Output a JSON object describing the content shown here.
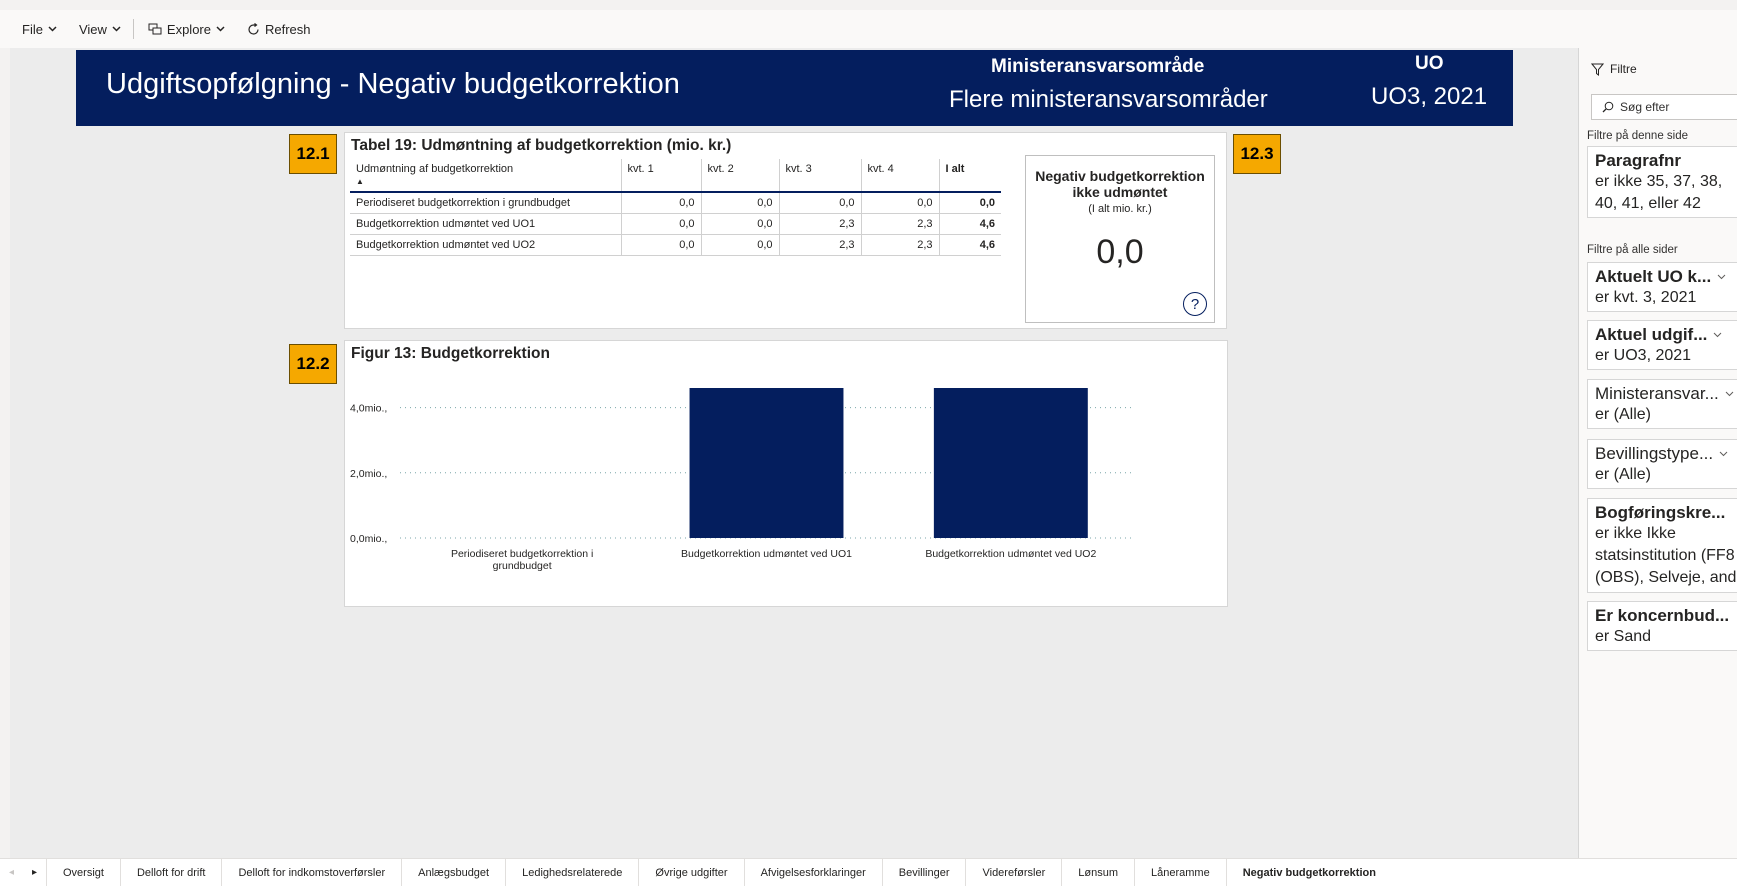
{
  "toolbar": {
    "file": "File",
    "view": "View",
    "explore": "Explore",
    "refresh": "Refresh"
  },
  "header": {
    "title": "Udgiftsopfølgning - Negativ budgetkorrektion",
    "ministry_label": "Ministeransvarsområde",
    "ministry_value": "Flere ministeransvarsområder",
    "uo_label": "UO",
    "uo_value": "UO3, 2021"
  },
  "badges": {
    "b1": "12.1",
    "b2": "12.2",
    "b3": "12.3"
  },
  "table": {
    "title": "Tabel 19: Udmøntning af budgetkorrektion (mio. kr.)",
    "headers": [
      "Udmøntning af budgetkorrektion",
      "kvt. 1",
      "kvt. 2",
      "kvt. 3",
      "kvt. 4",
      "I alt"
    ],
    "sort_indicator": "▲",
    "rows": [
      [
        "Periodiseret budgetkorrektion i grundbudget",
        "0,0",
        "0,0",
        "0,0",
        "0,0",
        "0,0"
      ],
      [
        "Budgetkorrektion udmøntet ved UO1",
        "0,0",
        "0,0",
        "2,3",
        "2,3",
        "4,6"
      ],
      [
        "Budgetkorrektion udmøntet ved UO2",
        "0,0",
        "0,0",
        "2,3",
        "2,3",
        "4,6"
      ]
    ]
  },
  "card": {
    "title": "Negativ budgetkorrektion ikke udmøntet",
    "subtitle": "(I alt mio. kr.)",
    "value": "0,0",
    "help": "?"
  },
  "chart_data": {
    "type": "bar",
    "title": "Figur 13: Budgetkorrektion",
    "categories": [
      "Periodiseret budgetkorrektion i grundbudget",
      "Budgetkorrektion udmøntet ved UO1",
      "Budgetkorrektion udmøntet ved UO2"
    ],
    "values": [
      0,
      4.6,
      4.6
    ],
    "ylim": [
      0,
      4.6
    ],
    "yticks": [
      0,
      2,
      4
    ],
    "ytick_labels": [
      "0,0mio.,",
      "2,0mio.,",
      "4,0mio.,"
    ],
    "grid": true,
    "bar_color": "#041e5e",
    "xlabel": "",
    "ylabel": ""
  },
  "filters": {
    "pane_title": "Filtre",
    "search_placeholder": "Søg efter",
    "this_page_label": "Filtre på denne side",
    "all_pages_label": "Filtre på alle sider",
    "items": [
      {
        "name": "Paragrafnr",
        "value": "er ikke 35, 37, 38,",
        "value2": "40, 41, eller 42"
      },
      {
        "name": "Aktuelt UO k...",
        "value": "er kvt. 3, 2021"
      },
      {
        "name": "Aktuel udgif...",
        "value": "er UO3, 2021"
      },
      {
        "name": "Ministeransvar...",
        "value": "er (Alle)"
      },
      {
        "name": "Bevillingstype...",
        "value": "er (Alle)"
      },
      {
        "name": "Bogføringskre...",
        "value": "er ikke Ikke",
        "value2": "statsinstitution (FF8",
        "value3": "(OBS), Selveje, and..."
      },
      {
        "name": "Er koncernbud...",
        "value": "er Sand"
      }
    ]
  },
  "tabs": [
    "Oversigt",
    "Delloft for drift",
    "Delloft for indkomstoverførsler",
    "Anlægsbudget",
    "Ledighedsrelaterede",
    "Øvrige udgifter",
    "Afvigelsesforklaringer",
    "Bevillinger",
    "Videreførsler",
    "Lønsum",
    "Låneramme",
    "Negativ budgetkorrektion"
  ],
  "active_tab": "Negativ budgetkorrektion"
}
